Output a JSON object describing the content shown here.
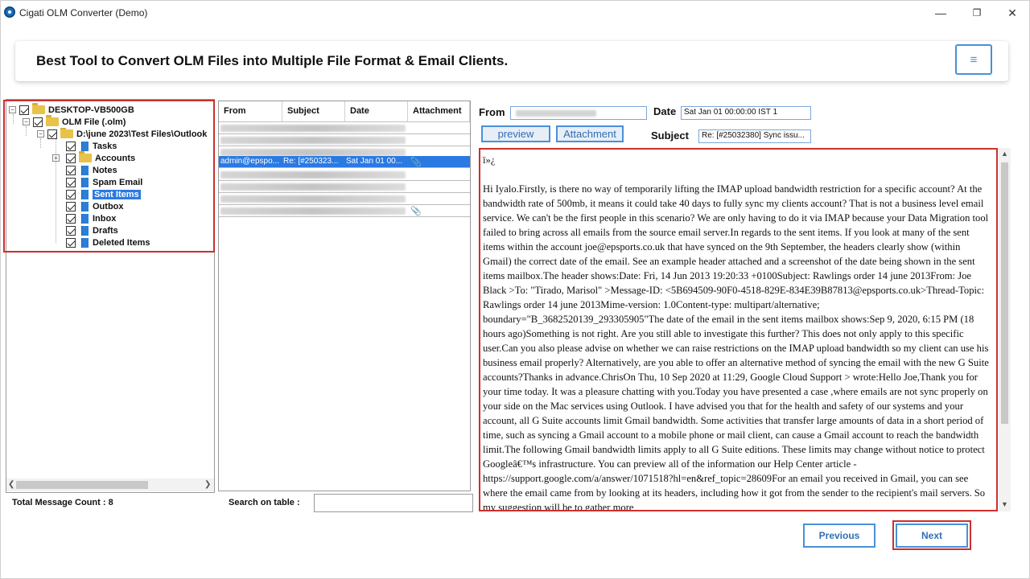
{
  "window": {
    "title": "Cigati OLM Converter (Demo)",
    "controls": {
      "minimize": "—",
      "maximize": "❐",
      "close": "✕"
    }
  },
  "banner": {
    "title": "Best Tool to Convert OLM Files into Multiple File Format & Email Clients.",
    "menu_icon": "≡"
  },
  "tree": {
    "root": "DESKTOP-VB500GB",
    "olm": "OLM File (.olm)",
    "path": "D:\\june 2023\\Test Files\\Outlook",
    "folders": [
      "Tasks",
      "Accounts",
      "Notes",
      "Spam Email",
      "Sent Items",
      "Outbox",
      "Inbox",
      "Drafts",
      "Deleted Items"
    ],
    "selected": "Sent Items"
  },
  "status": {
    "total_count": "Total Message Count : 8"
  },
  "table": {
    "headers": [
      "From",
      "Subject",
      "Date",
      "Attachment"
    ],
    "selected_row": {
      "from": "admin@epspo...",
      "subject": "Re: [#250323...",
      "date": "Sat Jan 01 00..."
    }
  },
  "search": {
    "label": "Search on table :",
    "value": ""
  },
  "header": {
    "from_label": "From",
    "date_label": "Date",
    "date_value": "Sat Jan 01 00:00:00 IST 1",
    "subject_label": "Subject",
    "subject_value": "Re: [#25032380] Sync issu...",
    "preview_btn": "preview",
    "attachment_btn": "Attachment"
  },
  "body": {
    "bom": "ï»¿",
    "text": "Hi Iyalo.Firstly, is there no way of temporarily lifting the IMAP upload bandwidth restriction for a specific account? At the bandwidth rate of 500mb, it means it could take 40 days to fully sync my clients account? That is not a business level email service. We can't be the first people in this scenario? We are only having to do it via IMAP because your Data Migration tool failed to bring across all emails from the source email server.In regards to the sent items. If you look at many of the sent items within the account joe@epsports.co.uk that have synced on the 9th September, the headers clearly show (within Gmail) the correct date of the email. See an example header attached and a screenshot of the date being shown in the sent items mailbox.The header shows:Date: Fri, 14 Jun 2013 19:20:33 +0100Subject: Rawlings order 14 june 2013From: Joe Black >To: \"Tirado, Marisol\" >Message-ID: <5B694509-90F0-4518-829E-834E39B87813@epsports.co.uk>Thread-Topic: Rawlings order 14 june 2013Mime-version: 1.0Content-type: multipart/alternative; boundary=\"B_3682520139_293305905\"The date of the email in the sent items mailbox shows:Sep 9, 2020, 6:15 PM (18 hours ago)Something is not right. Are you still able to investigate this further? This does not only apply to this specific user.Can you also please advise on whether we can raise restrictions on the IMAP upload bandwidth so my client can use his business email properly? Alternatively, are you able to offer an alternative method of syncing the email with the new G Suite accounts?Thanks in advance.ChrisOn Thu, 10 Sep 2020 at 11:29, Google Cloud Support > wrote:Hello Joe,Thank you for your time today. It was a pleasure chatting with you.Today you have presented a case ,where emails are not sync properly on your side on the Mac services using Outlook. I have advised you that for the health and safety of our systems and your account, all G Suite accounts limit Gmail bandwidth. Some activities that transfer large amounts of data in a short period of time, such as syncing a Gmail account to a mobile phone or mail client, can cause a Gmail account to reach the bandwidth limit.The following Gmail bandwidth limits apply to all G Suite editions. These limits may change without notice to protect Googleâ€™s infrastructure. You can preview all of the information our Help Center article - https://support.google.com/a/answer/1071518?hl=en&ref_topic=28609For an email you received in Gmail, you can see where the email came from by looking at its headers, including how it got from the sender to the recipient's mail servers. So my suggestion will be to gather more"
  },
  "nav": {
    "previous": "Previous",
    "next": "Next"
  }
}
